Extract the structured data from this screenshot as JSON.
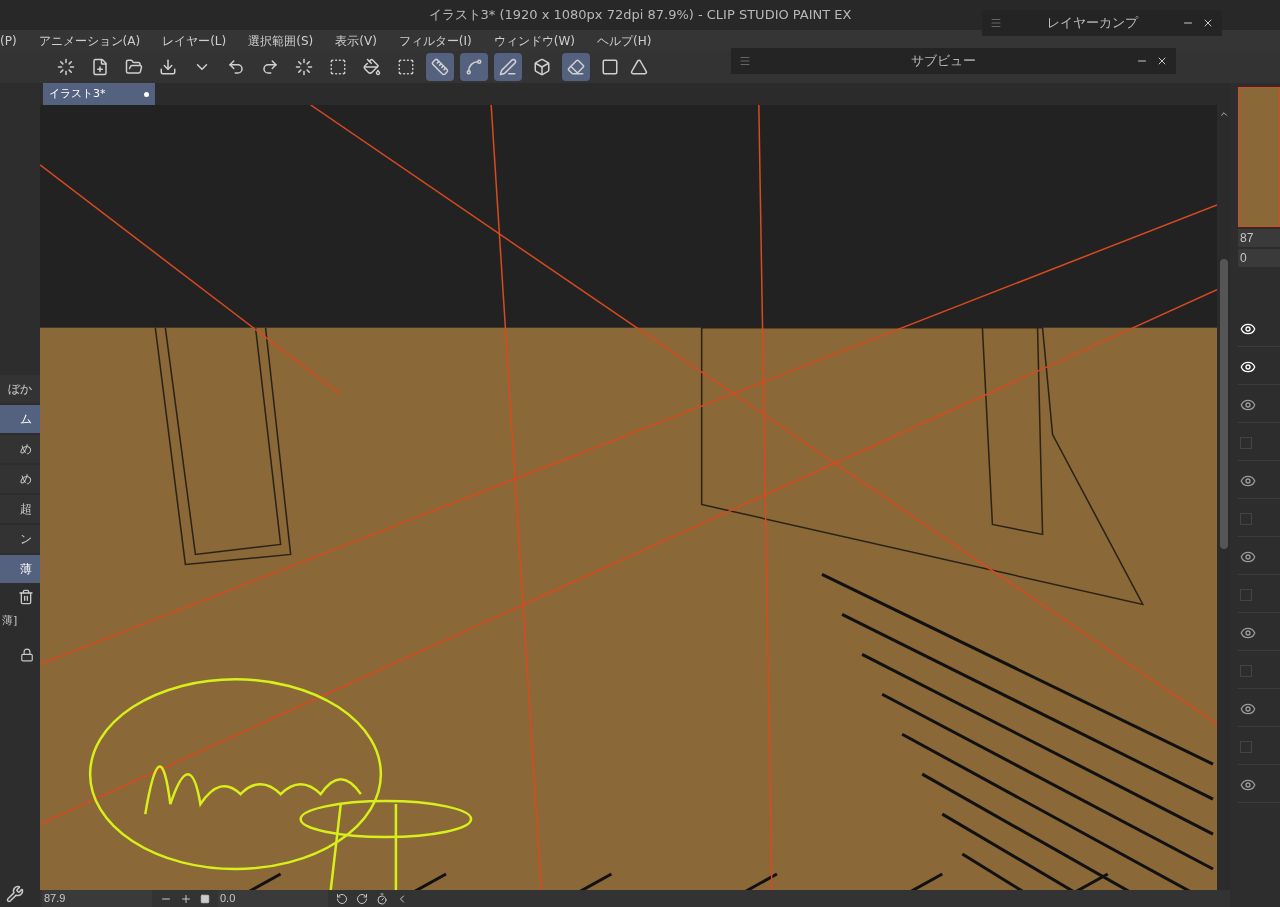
{
  "window": {
    "title": "イラスト3* (1920 x 1080px 72dpi 87.9%)  - CLIP STUDIO PAINT EX"
  },
  "menu": [
    "(P)",
    "アニメーション(A)",
    "レイヤー(L)",
    "選択範囲(S)",
    "表示(V)",
    "フィルター(I)",
    "ウィンドウ(W)",
    "ヘルプ(H)"
  ],
  "floating_windows": [
    {
      "title": "レイヤーカンプ"
    },
    {
      "title": "サブビュー"
    }
  ],
  "toolbar": [
    {
      "selected": false
    },
    {
      "selected": false
    },
    {
      "selected": false
    },
    {
      "selected": false
    },
    {
      "selected": false
    },
    {
      "selected": false
    },
    {
      "selected": false
    },
    {
      "selected": false
    },
    {
      "selected": false
    },
    {
      "selected": false
    },
    {
      "selected": false
    },
    {
      "selected": true
    },
    {
      "selected": true
    },
    {
      "selected": true
    },
    {
      "selected": false
    },
    {
      "selected": true
    },
    {
      "selected": false
    }
  ],
  "tabs": [
    {
      "label": "イラスト3*",
      "selected": true
    }
  ],
  "left_panel": {
    "items": [
      {
        "label": "ぼか",
        "selected": false
      },
      {
        "label": "ム",
        "selected": true
      },
      {
        "label": "め",
        "selected": false
      },
      {
        "label": "め",
        "selected": false
      },
      {
        "label": "超",
        "selected": false
      },
      {
        "label": "ン",
        "selected": false
      },
      {
        "label": "薄",
        "selected": true
      }
    ],
    "footer_tab": "薄]"
  },
  "right_panel": {
    "zoom": "87",
    "angle": "0",
    "layers": [
      {
        "visible": true
      },
      {
        "visible": true
      },
      {
        "visible": true
      },
      {
        "visible": false
      },
      {
        "visible": true
      },
      {
        "visible": false
      },
      {
        "visible": true
      },
      {
        "visible": false
      },
      {
        "visible": true
      },
      {
        "visible": false
      },
      {
        "visible": true
      },
      {
        "visible": false
      },
      {
        "visible": true
      }
    ]
  },
  "status_bar": {
    "zoom": "87.9",
    "angle": "0.0"
  }
}
